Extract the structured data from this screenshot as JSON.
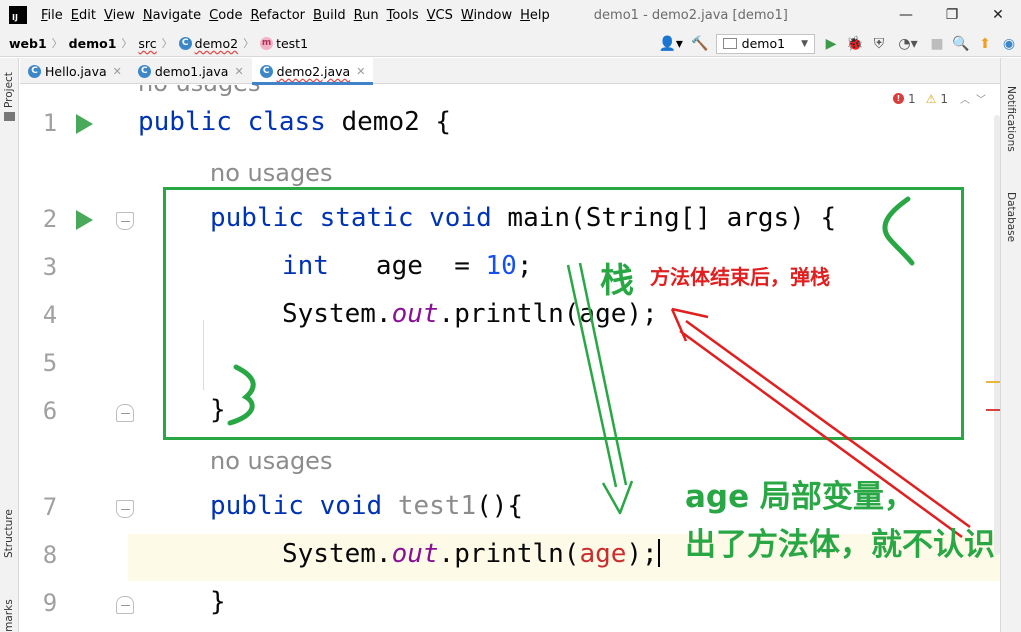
{
  "menubar": {
    "logo": "IJ",
    "items": [
      {
        "mnemonic": "F",
        "rest": "ile"
      },
      {
        "mnemonic": "E",
        "rest": "dit"
      },
      {
        "mnemonic": "V",
        "rest": "iew"
      },
      {
        "mnemonic": "N",
        "rest": "avigate"
      },
      {
        "mnemonic": "C",
        "rest": "ode"
      },
      {
        "mnemonic": "R",
        "rest": "efactor"
      },
      {
        "mnemonic": "B",
        "rest": "uild"
      },
      {
        "mnemonic": "R",
        "rest": "un"
      },
      {
        "mnemonic": "T",
        "rest": "ools"
      },
      {
        "mnemonic": "V",
        "rest": "CS"
      },
      {
        "mnemonic": "W",
        "rest": "indow"
      },
      {
        "mnemonic": "H",
        "rest": "elp"
      }
    ],
    "window_title": "demo1 - demo2.java [demo1]",
    "win_minimize": "—",
    "win_restore": "❐",
    "win_close": "✕"
  },
  "navbar": {
    "crumbs": [
      "web1",
      "demo1",
      "src",
      "demo2",
      "test1"
    ],
    "class_icon": "C",
    "method_icon": "m",
    "run_config": "demo1",
    "icons": {
      "user": "👤▾",
      "hammer": "🔨",
      "run": "▶",
      "debug": "🐞",
      "coverage": "⛨",
      "profile": "◔▾",
      "stop": "■",
      "search": "🔍",
      "update": "⬆",
      "logo": "◉"
    }
  },
  "left_strip": {
    "project": "Project",
    "structure": "Structure",
    "bookmarks": "Bookmarks"
  },
  "right_strip": {
    "notifications": "Notifications",
    "database": "Database"
  },
  "tabs": [
    {
      "label": "Hello.java",
      "close": "✕"
    },
    {
      "label": "demo1.java",
      "close": "✕"
    },
    {
      "label": "demo2.java",
      "close": "✕"
    }
  ],
  "inspection": {
    "errors": "1",
    "warnings": "1",
    "err_glyph": "!",
    "warn_glyph": "⚠"
  },
  "hints": {
    "top": "no usages",
    "main": "no usages",
    "test1": "no usages"
  },
  "line_numbers": [
    "1",
    "2",
    "3",
    "4",
    "5",
    "6",
    "7",
    "8",
    "9"
  ],
  "code": {
    "l1_kw": "public class ",
    "l1_rest": "demo2 {",
    "l2_kw": "public static void ",
    "l2_rest": "main(String[] args) {",
    "l3_kw": "int",
    "l3_mid": "   age  = ",
    "l3_num": "10",
    "l3_end": ";",
    "l4_a": "System.",
    "l4_out": "out",
    "l4_b": ".println(age);",
    "l6": "}",
    "l7_kw": "public void ",
    "l7_name": "test1",
    "l7_rest": "(){",
    "l8_a": "System.",
    "l8_out": "out",
    "l8_b": ".println(",
    "l8_var": "age",
    "l8_c": ");",
    "l9": "}"
  },
  "annotations": {
    "stack": "栈",
    "pop": "方法体结束后，弹栈",
    "local_line1": "age 局部变量，",
    "local_line2": "出了方法体，就不认识"
  }
}
